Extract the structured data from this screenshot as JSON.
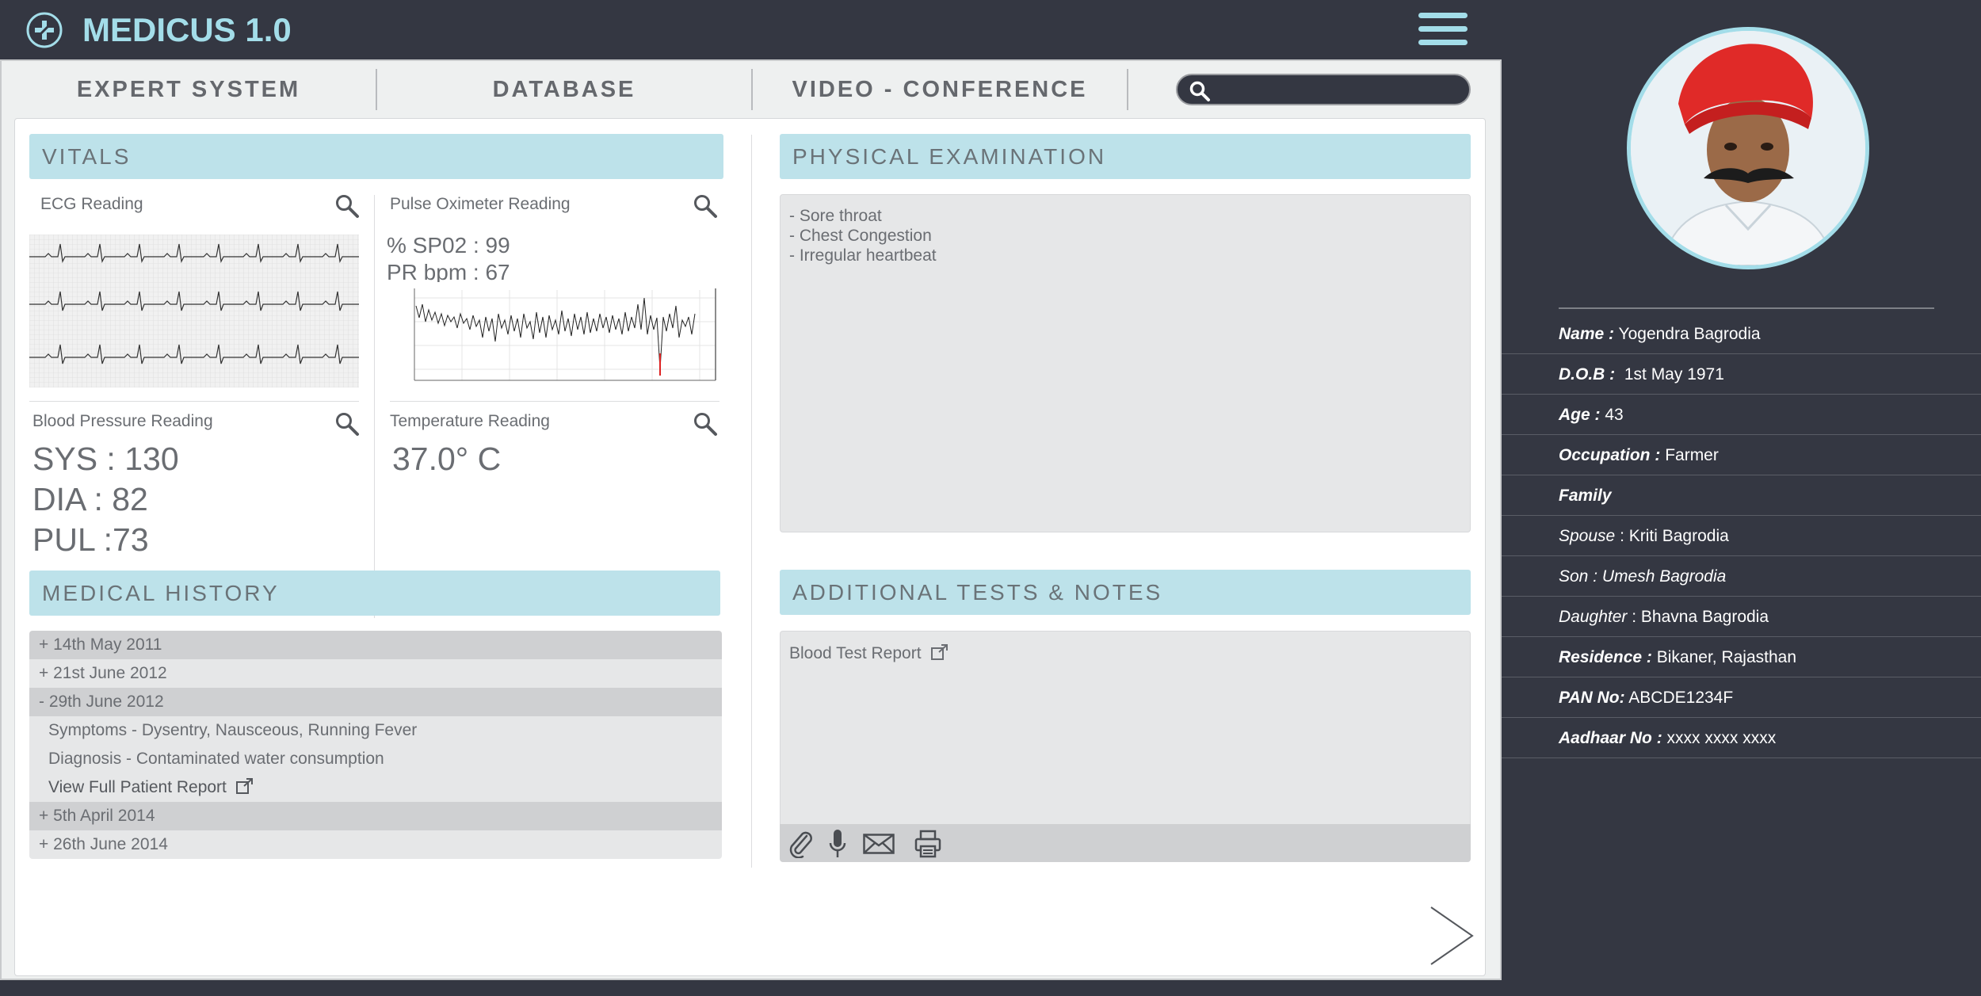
{
  "app": {
    "title": "MEDICUS 1.0"
  },
  "nav": {
    "tabs": [
      "EXPERT  SYSTEM",
      "DATABASE",
      "VIDEO - CONFERENCE"
    ],
    "search_placeholder": ""
  },
  "vitals": {
    "heading": "VITALS",
    "ecg_label": "ECG Reading",
    "pulse_label": "Pulse Oximeter Reading",
    "spo2": "% SP02 : 99",
    "pr_bpm": "PR bpm : 67",
    "bp_label": "Blood Pressure Reading",
    "sys": "SYS : 130",
    "dia": "DIA : 82",
    "pul": "PUL :73",
    "temp_label": "Temperature Reading",
    "temp": "37.0° C"
  },
  "physical": {
    "heading": "PHYSICAL EXAMINATION",
    "notes": [
      "- Sore throat",
      "- Chest Congestion",
      "- Irregular heartbeat"
    ]
  },
  "history": {
    "heading": "MEDICAL HISTORY",
    "entries": [
      "+ 14th May 2011",
      "+ 21st June 2012",
      "- 29th June 2012",
      "+ 5th April 2014",
      "+ 26th June 2014"
    ],
    "expanded": {
      "symptoms": "Symptoms - Dysentry, Nausceous, Running Fever",
      "diagnosis": "Diagnosis - Contaminated water consumption",
      "report_link": "View Full Patient Report"
    }
  },
  "tests": {
    "heading": "ADDITIONAL TESTS & NOTES",
    "blood_report": "Blood Test Report",
    "toolbar_icons": [
      "paperclip-icon",
      "microphone-icon",
      "mail-icon",
      "printer-icon"
    ]
  },
  "patient": {
    "name_label": "Name :",
    "name": "Yogendra Bagrodia",
    "dob_label": "D.O.B :",
    "dob": "1st May 1971",
    "age_label": "Age :",
    "age": "43",
    "occ_label": "Occupation :",
    "occupation": "Farmer",
    "family_label": "Family",
    "spouse_label": "Spouse",
    "spouse": ": Kriti  Bagrodia",
    "son_label": "Son",
    "son": ": Umesh Bagrodia",
    "daughter_label": "Daughter",
    "daughter": ": Bhavna Bagrodia",
    "res_label": "Residence :",
    "residence": "Bikaner, Rajasthan",
    "pan_label": "PAN No:",
    "pan": "ABCDE1234F",
    "aadhaar_label": "Aadhaar No :",
    "aadhaar": "xxxx xxxx xxxx"
  },
  "colors": {
    "accent": "#a3dde9",
    "dark": "#343742",
    "section": "#bde2ea"
  }
}
